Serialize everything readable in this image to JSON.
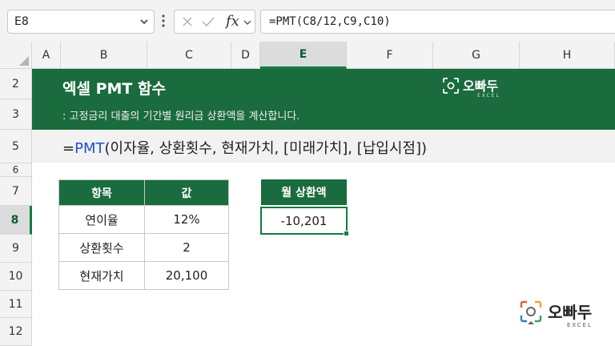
{
  "formula_bar": {
    "name_box": "E8",
    "fx_label": "fx",
    "formula": "=PMT(C8/12,C9,C10)"
  },
  "columns": [
    "A",
    "B",
    "C",
    "D",
    "E",
    "F",
    "G",
    "H"
  ],
  "selected_column": "E",
  "rows": [
    "2",
    "3",
    "5",
    "6",
    "7",
    "8",
    "9",
    "10",
    "11",
    "12"
  ],
  "selected_row": "8",
  "banner": {
    "title": "엑셀 PMT 함수",
    "subtitle": ": 고정금리 대출의 기간별 원리금 상환액을 계산합니다.",
    "logo_text": "오빠두",
    "logo_sub": "EXCEL"
  },
  "syntax": {
    "prefix": "=",
    "function": "PMT",
    "args": "(이자율, 상환횟수, 현재가치, [미래가치], [납입시점])"
  },
  "table": {
    "headers": [
      "항목",
      "값"
    ],
    "rows": [
      [
        "연이율",
        "12%"
      ],
      [
        "상환횟수",
        "2"
      ],
      [
        "현재가치",
        "20,100"
      ]
    ]
  },
  "result": {
    "header": "월 상환액",
    "value": "-10,201"
  },
  "watermark": {
    "text": "오빠두",
    "sub": "EXCEL"
  },
  "colors": {
    "header_green": "#1a6b3d",
    "selection_green": "#107c41",
    "function_blue": "#1f4fd6"
  }
}
